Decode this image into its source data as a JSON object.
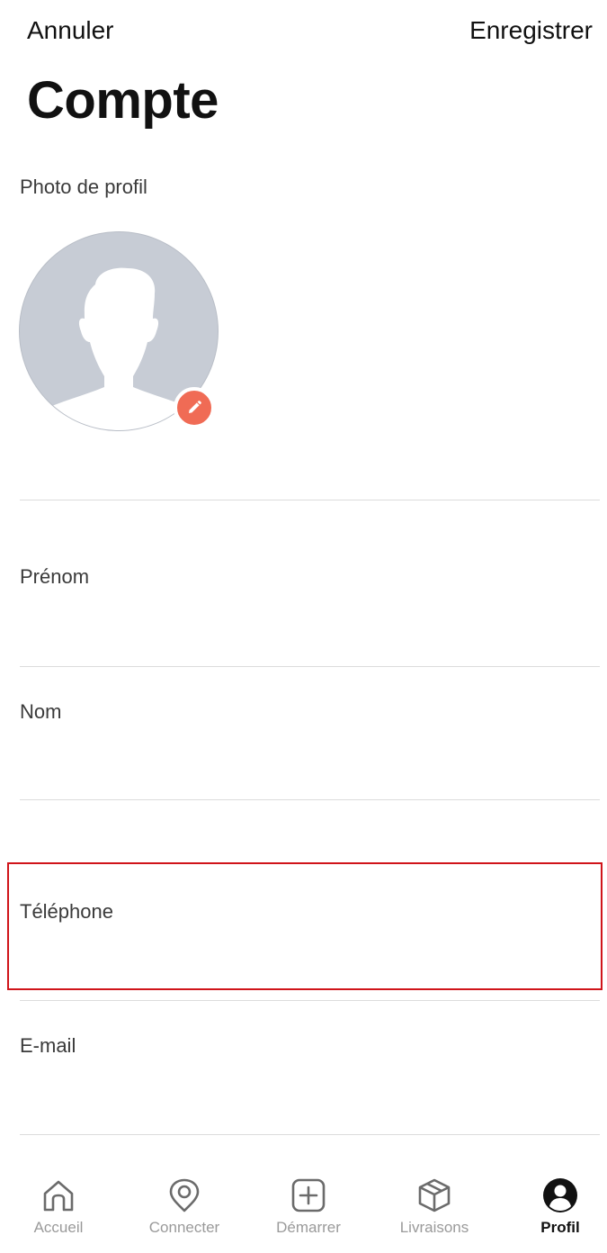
{
  "header": {
    "cancel_label": "Annuler",
    "save_label": "Enregistrer",
    "title": "Compte"
  },
  "profile_photo": {
    "label": "Photo de profil"
  },
  "fields": {
    "first_name": {
      "label": "Prénom",
      "value": ""
    },
    "last_name": {
      "label": "Nom",
      "value": ""
    },
    "phone": {
      "label": "Téléphone",
      "value": ""
    },
    "email": {
      "label": "E-mail",
      "value": ""
    }
  },
  "highlight_color": "#d0141a",
  "accent_color": "#f06b55",
  "tabbar": {
    "items": [
      {
        "label": "Accueil",
        "icon": "home-icon",
        "active": false
      },
      {
        "label": "Connecter",
        "icon": "location-pin-icon",
        "active": false
      },
      {
        "label": "Démarrer",
        "icon": "plus-square-icon",
        "active": false
      },
      {
        "label": "Livraisons",
        "icon": "package-icon",
        "active": false
      },
      {
        "label": "Profil",
        "icon": "user-circle-icon",
        "active": true
      }
    ]
  }
}
